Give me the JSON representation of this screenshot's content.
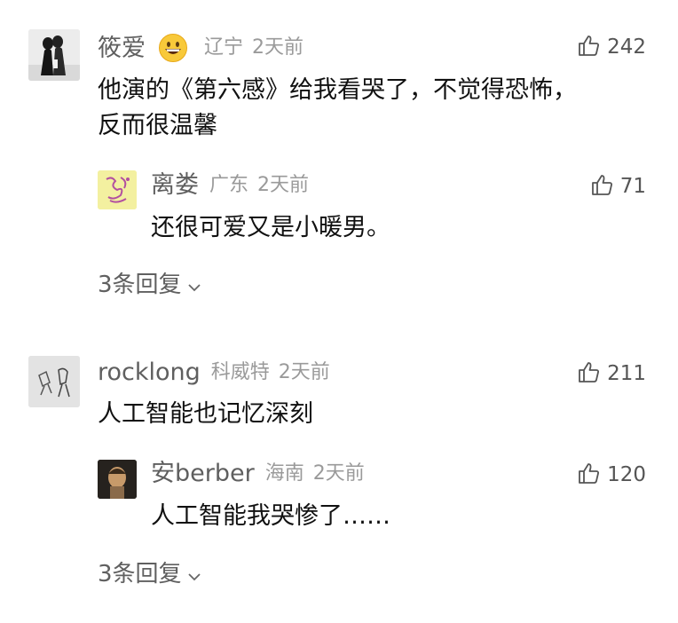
{
  "comments": [
    {
      "username": "筱爱",
      "emoji": "grinning-face-emoji",
      "location": "辽宁",
      "time": "2天前",
      "likes": "242",
      "text_line1": "他演的《第六感》给我看哭了，不觉得恐怖，",
      "text_line2": "反而很温馨",
      "reply": {
        "username": "离娄",
        "location": "广东",
        "time": "2天前",
        "likes": "71",
        "text": "还很可爱又是小暖男。"
      },
      "more_replies": "3条回复"
    },
    {
      "username": "rocklong",
      "location": "科威特",
      "time": "2天前",
      "likes": "211",
      "text": "人工智能也记忆深刻",
      "reply": {
        "username": "安berber",
        "location": "海南",
        "time": "2天前",
        "likes": "120",
        "text": "人工智能我哭惨了……"
      },
      "more_replies": "3条回复"
    }
  ],
  "icons": {
    "like": "thumbs-up-icon",
    "expand": "chevron-down-icon"
  }
}
